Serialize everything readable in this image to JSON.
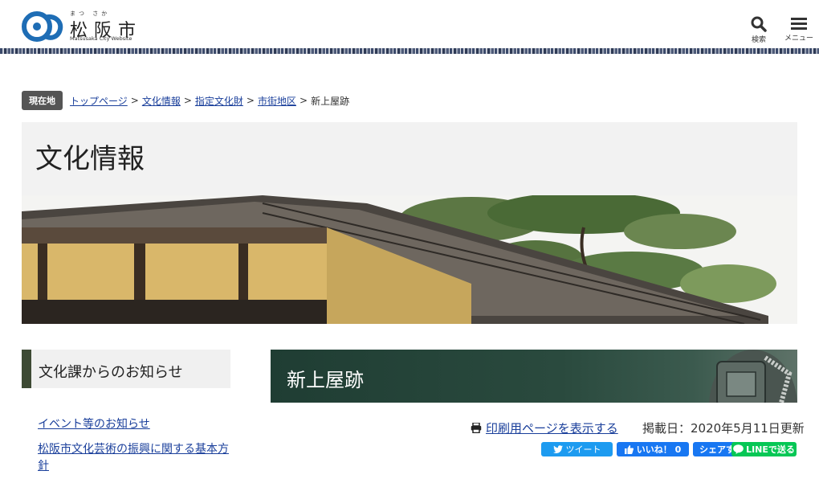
{
  "header": {
    "logo_ruby": "まつ さか",
    "logo_name": "松阪市",
    "logo_sub": "Matsusaka City Website",
    "search_label": "検索",
    "menu_label": "メニュー"
  },
  "breadcrumb": {
    "label": "現在地",
    "items": [
      "トップページ",
      "文化情報",
      "指定文化財",
      "市街地区"
    ],
    "separator": ">",
    "current": "新上屋跡"
  },
  "page": {
    "section_title": "文化情報"
  },
  "sidebar": {
    "heading": "文化課からのお知らせ",
    "links": [
      "イベント等のお知らせ",
      "松阪市文化芸術の振興に関する基本方針"
    ]
  },
  "article": {
    "title": "新上屋跡",
    "print_label": "印刷用ページを表示する",
    "date_text": "掲載日：2020年5月11日更新"
  },
  "sns": {
    "tweet": "ツイート",
    "like": "いいね！ 0",
    "share": "シェアする",
    "line": "LINEで送る"
  },
  "colors": {
    "link": "#1a3f9b",
    "sidebar_accent": "#3d4a34",
    "heading_band": "#1f3d33",
    "logo_blue": "#1e6db5"
  }
}
